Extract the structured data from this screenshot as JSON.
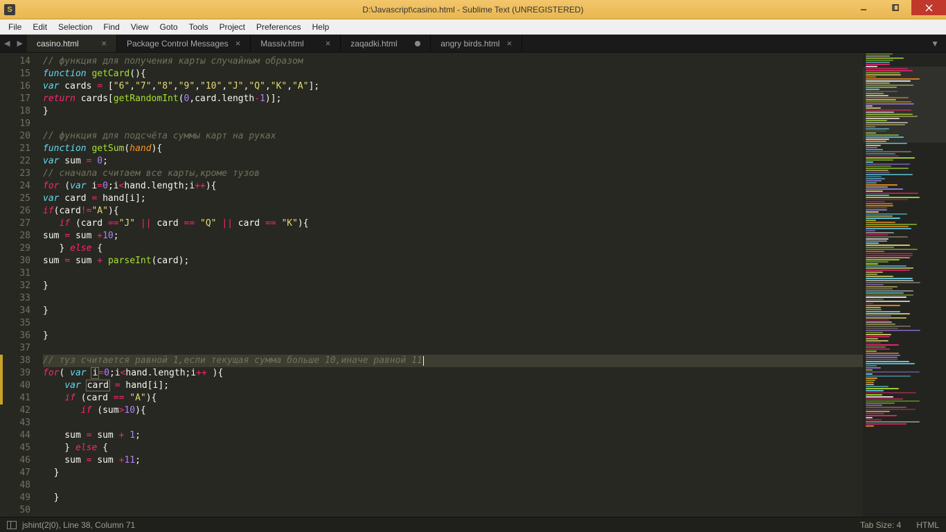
{
  "window": {
    "title": "D:\\Javascript\\casino.html - Sublime Text (UNREGISTERED)"
  },
  "menu": [
    "File",
    "Edit",
    "Selection",
    "Find",
    "View",
    "Goto",
    "Tools",
    "Project",
    "Preferences",
    "Help"
  ],
  "tabs": [
    {
      "label": "casino.html",
      "active": true,
      "dirty": false
    },
    {
      "label": "Package Control Messages",
      "active": false,
      "dirty": false
    },
    {
      "label": "Massiv.html",
      "active": false,
      "dirty": false
    },
    {
      "label": "zaqadki.html",
      "active": false,
      "dirty": true
    },
    {
      "label": "angry birds.html",
      "active": false,
      "dirty": false
    }
  ],
  "gutter": {
    "start": 14,
    "end": 50,
    "modified": [
      38,
      39,
      40,
      41
    ]
  },
  "code": {
    "lines": [
      {
        "n": 14,
        "tokens": [
          [
            "cm",
            "// функция для получения карты случайным образом"
          ]
        ]
      },
      {
        "n": 15,
        "tokens": [
          [
            "st",
            "function"
          ],
          [
            "id",
            " "
          ],
          [
            "fn",
            "getCard"
          ],
          [
            "id",
            "(){"
          ]
        ]
      },
      {
        "n": 16,
        "tokens": [
          [
            "st",
            "var"
          ],
          [
            "id",
            " cards "
          ],
          [
            "op",
            "="
          ],
          [
            "id",
            " ["
          ],
          [
            "str",
            "\"6\""
          ],
          [
            "id",
            ","
          ],
          [
            "str",
            "\"7\""
          ],
          [
            "id",
            ","
          ],
          [
            "str",
            "\"8\""
          ],
          [
            "id",
            ","
          ],
          [
            "str",
            "\"9\""
          ],
          [
            "id",
            ","
          ],
          [
            "str",
            "\"10\""
          ],
          [
            "id",
            ","
          ],
          [
            "str",
            "\"J\""
          ],
          [
            "id",
            ","
          ],
          [
            "str",
            "\"Q\""
          ],
          [
            "id",
            ","
          ],
          [
            "str",
            "\"K\""
          ],
          [
            "id",
            ","
          ],
          [
            "str",
            "\"A\""
          ],
          [
            "id",
            "];"
          ]
        ]
      },
      {
        "n": 17,
        "tokens": [
          [
            "kw",
            "return"
          ],
          [
            "id",
            " cards["
          ],
          [
            "fn",
            "getRandomInt"
          ],
          [
            "id",
            "("
          ],
          [
            "nm",
            "0"
          ],
          [
            "id",
            ",card.length"
          ],
          [
            "op",
            "-"
          ],
          [
            "nm",
            "1"
          ],
          [
            "id",
            ")];"
          ]
        ]
      },
      {
        "n": 18,
        "tokens": [
          [
            "id",
            "}"
          ]
        ]
      },
      {
        "n": 19,
        "tokens": []
      },
      {
        "n": 20,
        "tokens": [
          [
            "cm",
            "// функция для подсчёта суммы карт на руках"
          ]
        ]
      },
      {
        "n": 21,
        "tokens": [
          [
            "st",
            "function"
          ],
          [
            "id",
            " "
          ],
          [
            "fn",
            "getSum"
          ],
          [
            "id",
            "("
          ],
          [
            "pr",
            "hand"
          ],
          [
            "id",
            "){"
          ]
        ]
      },
      {
        "n": 22,
        "tokens": [
          [
            "st",
            "var"
          ],
          [
            "id",
            " sum "
          ],
          [
            "op",
            "="
          ],
          [
            "id",
            " "
          ],
          [
            "nm",
            "0"
          ],
          [
            "id",
            ";"
          ]
        ]
      },
      {
        "n": 23,
        "tokens": [
          [
            "cm",
            "// сначала считаем все карты,кроме тузов"
          ]
        ]
      },
      {
        "n": 24,
        "tokens": [
          [
            "kw",
            "for"
          ],
          [
            "id",
            " ("
          ],
          [
            "st",
            "var"
          ],
          [
            "id",
            " i"
          ],
          [
            "op",
            "="
          ],
          [
            "nm",
            "0"
          ],
          [
            "id",
            ";i"
          ],
          [
            "op",
            "<"
          ],
          [
            "id",
            "hand.length;i"
          ],
          [
            "op",
            "++"
          ],
          [
            "id",
            "){"
          ]
        ]
      },
      {
        "n": 25,
        "tokens": [
          [
            "st",
            "var"
          ],
          [
            "id",
            " card "
          ],
          [
            "op",
            "="
          ],
          [
            "id",
            " hand[i];"
          ]
        ]
      },
      {
        "n": 26,
        "tokens": [
          [
            "kw",
            "if"
          ],
          [
            "id",
            "(card"
          ],
          [
            "op",
            "!="
          ],
          [
            "str",
            "\"A\""
          ],
          [
            "id",
            "){"
          ]
        ]
      },
      {
        "n": 27,
        "tokens": [
          [
            "id",
            "   "
          ],
          [
            "kw",
            "if"
          ],
          [
            "id",
            " (card "
          ],
          [
            "op",
            "=="
          ],
          [
            "str",
            "\"J\""
          ],
          [
            "id",
            " "
          ],
          [
            "op",
            "||"
          ],
          [
            "id",
            " card "
          ],
          [
            "op",
            "=="
          ],
          [
            "id",
            " "
          ],
          [
            "str",
            "\"Q\""
          ],
          [
            "id",
            " "
          ],
          [
            "op",
            "||"
          ],
          [
            "id",
            " card "
          ],
          [
            "op",
            "=="
          ],
          [
            "id",
            " "
          ],
          [
            "str",
            "\"K\""
          ],
          [
            "id",
            "){"
          ]
        ]
      },
      {
        "n": 28,
        "tokens": [
          [
            "id",
            "sum "
          ],
          [
            "op",
            "="
          ],
          [
            "id",
            " sum "
          ],
          [
            "op",
            "+"
          ],
          [
            "nm",
            "10"
          ],
          [
            "id",
            ";"
          ]
        ]
      },
      {
        "n": 29,
        "tokens": [
          [
            "id",
            "   } "
          ],
          [
            "kw",
            "else"
          ],
          [
            "id",
            " {"
          ]
        ]
      },
      {
        "n": 30,
        "tokens": [
          [
            "id",
            "sum "
          ],
          [
            "op",
            "="
          ],
          [
            "id",
            " sum "
          ],
          [
            "op",
            "+"
          ],
          [
            "id",
            " "
          ],
          [
            "fn",
            "parseInt"
          ],
          [
            "id",
            "(card);"
          ]
        ]
      },
      {
        "n": 31,
        "tokens": []
      },
      {
        "n": 32,
        "tokens": [
          [
            "id",
            "}"
          ]
        ]
      },
      {
        "n": 33,
        "tokens": []
      },
      {
        "n": 34,
        "tokens": [
          [
            "id",
            "}"
          ]
        ]
      },
      {
        "n": 35,
        "tokens": []
      },
      {
        "n": 36,
        "tokens": [
          [
            "id",
            "}"
          ]
        ]
      },
      {
        "n": 37,
        "tokens": []
      },
      {
        "n": 38,
        "hl": true,
        "cursor": true,
        "tokens": [
          [
            "cm",
            "// туз считается равной 1,если текущая сумма больше 10,иначе равной 11"
          ]
        ]
      },
      {
        "n": 39,
        "tokens": [
          [
            "kw",
            "for"
          ],
          [
            "id",
            "( "
          ],
          [
            "st",
            "var"
          ],
          [
            "id",
            " "
          ],
          [
            "box",
            "i"
          ],
          [
            "op",
            "="
          ],
          [
            "nm",
            "0"
          ],
          [
            "id",
            ";i"
          ],
          [
            "op",
            "<"
          ],
          [
            "id",
            "hand.length;i"
          ],
          [
            "op",
            "++"
          ],
          [
            "id",
            " ){"
          ]
        ]
      },
      {
        "n": 40,
        "tokens": [
          [
            "id",
            "    "
          ],
          [
            "st",
            "var"
          ],
          [
            "id",
            " "
          ],
          [
            "box",
            "card"
          ],
          [
            "id",
            " "
          ],
          [
            "op",
            "="
          ],
          [
            "id",
            " hand[i];"
          ]
        ]
      },
      {
        "n": 41,
        "tokens": [
          [
            "id",
            "    "
          ],
          [
            "kw",
            "if"
          ],
          [
            "id",
            " (card "
          ],
          [
            "op",
            "=="
          ],
          [
            "id",
            " "
          ],
          [
            "str",
            "\"A\""
          ],
          [
            "id",
            "){"
          ]
        ]
      },
      {
        "n": 42,
        "tokens": [
          [
            "id",
            "       "
          ],
          [
            "kw",
            "if"
          ],
          [
            "id",
            " (sum"
          ],
          [
            "op",
            ">"
          ],
          [
            "nm",
            "10"
          ],
          [
            "id",
            "){"
          ]
        ]
      },
      {
        "n": 43,
        "tokens": []
      },
      {
        "n": 44,
        "tokens": [
          [
            "id",
            "    sum "
          ],
          [
            "op",
            "="
          ],
          [
            "id",
            " sum "
          ],
          [
            "op",
            "+"
          ],
          [
            "id",
            " "
          ],
          [
            "nm",
            "1"
          ],
          [
            "id",
            ";"
          ]
        ]
      },
      {
        "n": 45,
        "tokens": [
          [
            "id",
            "    } "
          ],
          [
            "kw",
            "else"
          ],
          [
            "id",
            " {"
          ]
        ]
      },
      {
        "n": 46,
        "tokens": [
          [
            "id",
            "    sum "
          ],
          [
            "op",
            "="
          ],
          [
            "id",
            " sum "
          ],
          [
            "op",
            "+"
          ],
          [
            "nm",
            "11"
          ],
          [
            "id",
            ";"
          ]
        ]
      },
      {
        "n": 47,
        "tokens": [
          [
            "id",
            "  }"
          ]
        ]
      },
      {
        "n": 48,
        "tokens": []
      },
      {
        "n": 49,
        "tokens": [
          [
            "id",
            "  }"
          ]
        ]
      },
      {
        "n": 50,
        "tokens": []
      }
    ]
  },
  "status": {
    "left": "jshint(2|0), Line 38, Column 71",
    "tab_size": "Tab Size: 4",
    "syntax": "HTML"
  },
  "minimap_colors": [
    "#75715e",
    "#66d9ef",
    "#a6e22e",
    "#f92672",
    "#e6db74",
    "#ae81ff",
    "#f8f8f2",
    "#fd971f"
  ]
}
